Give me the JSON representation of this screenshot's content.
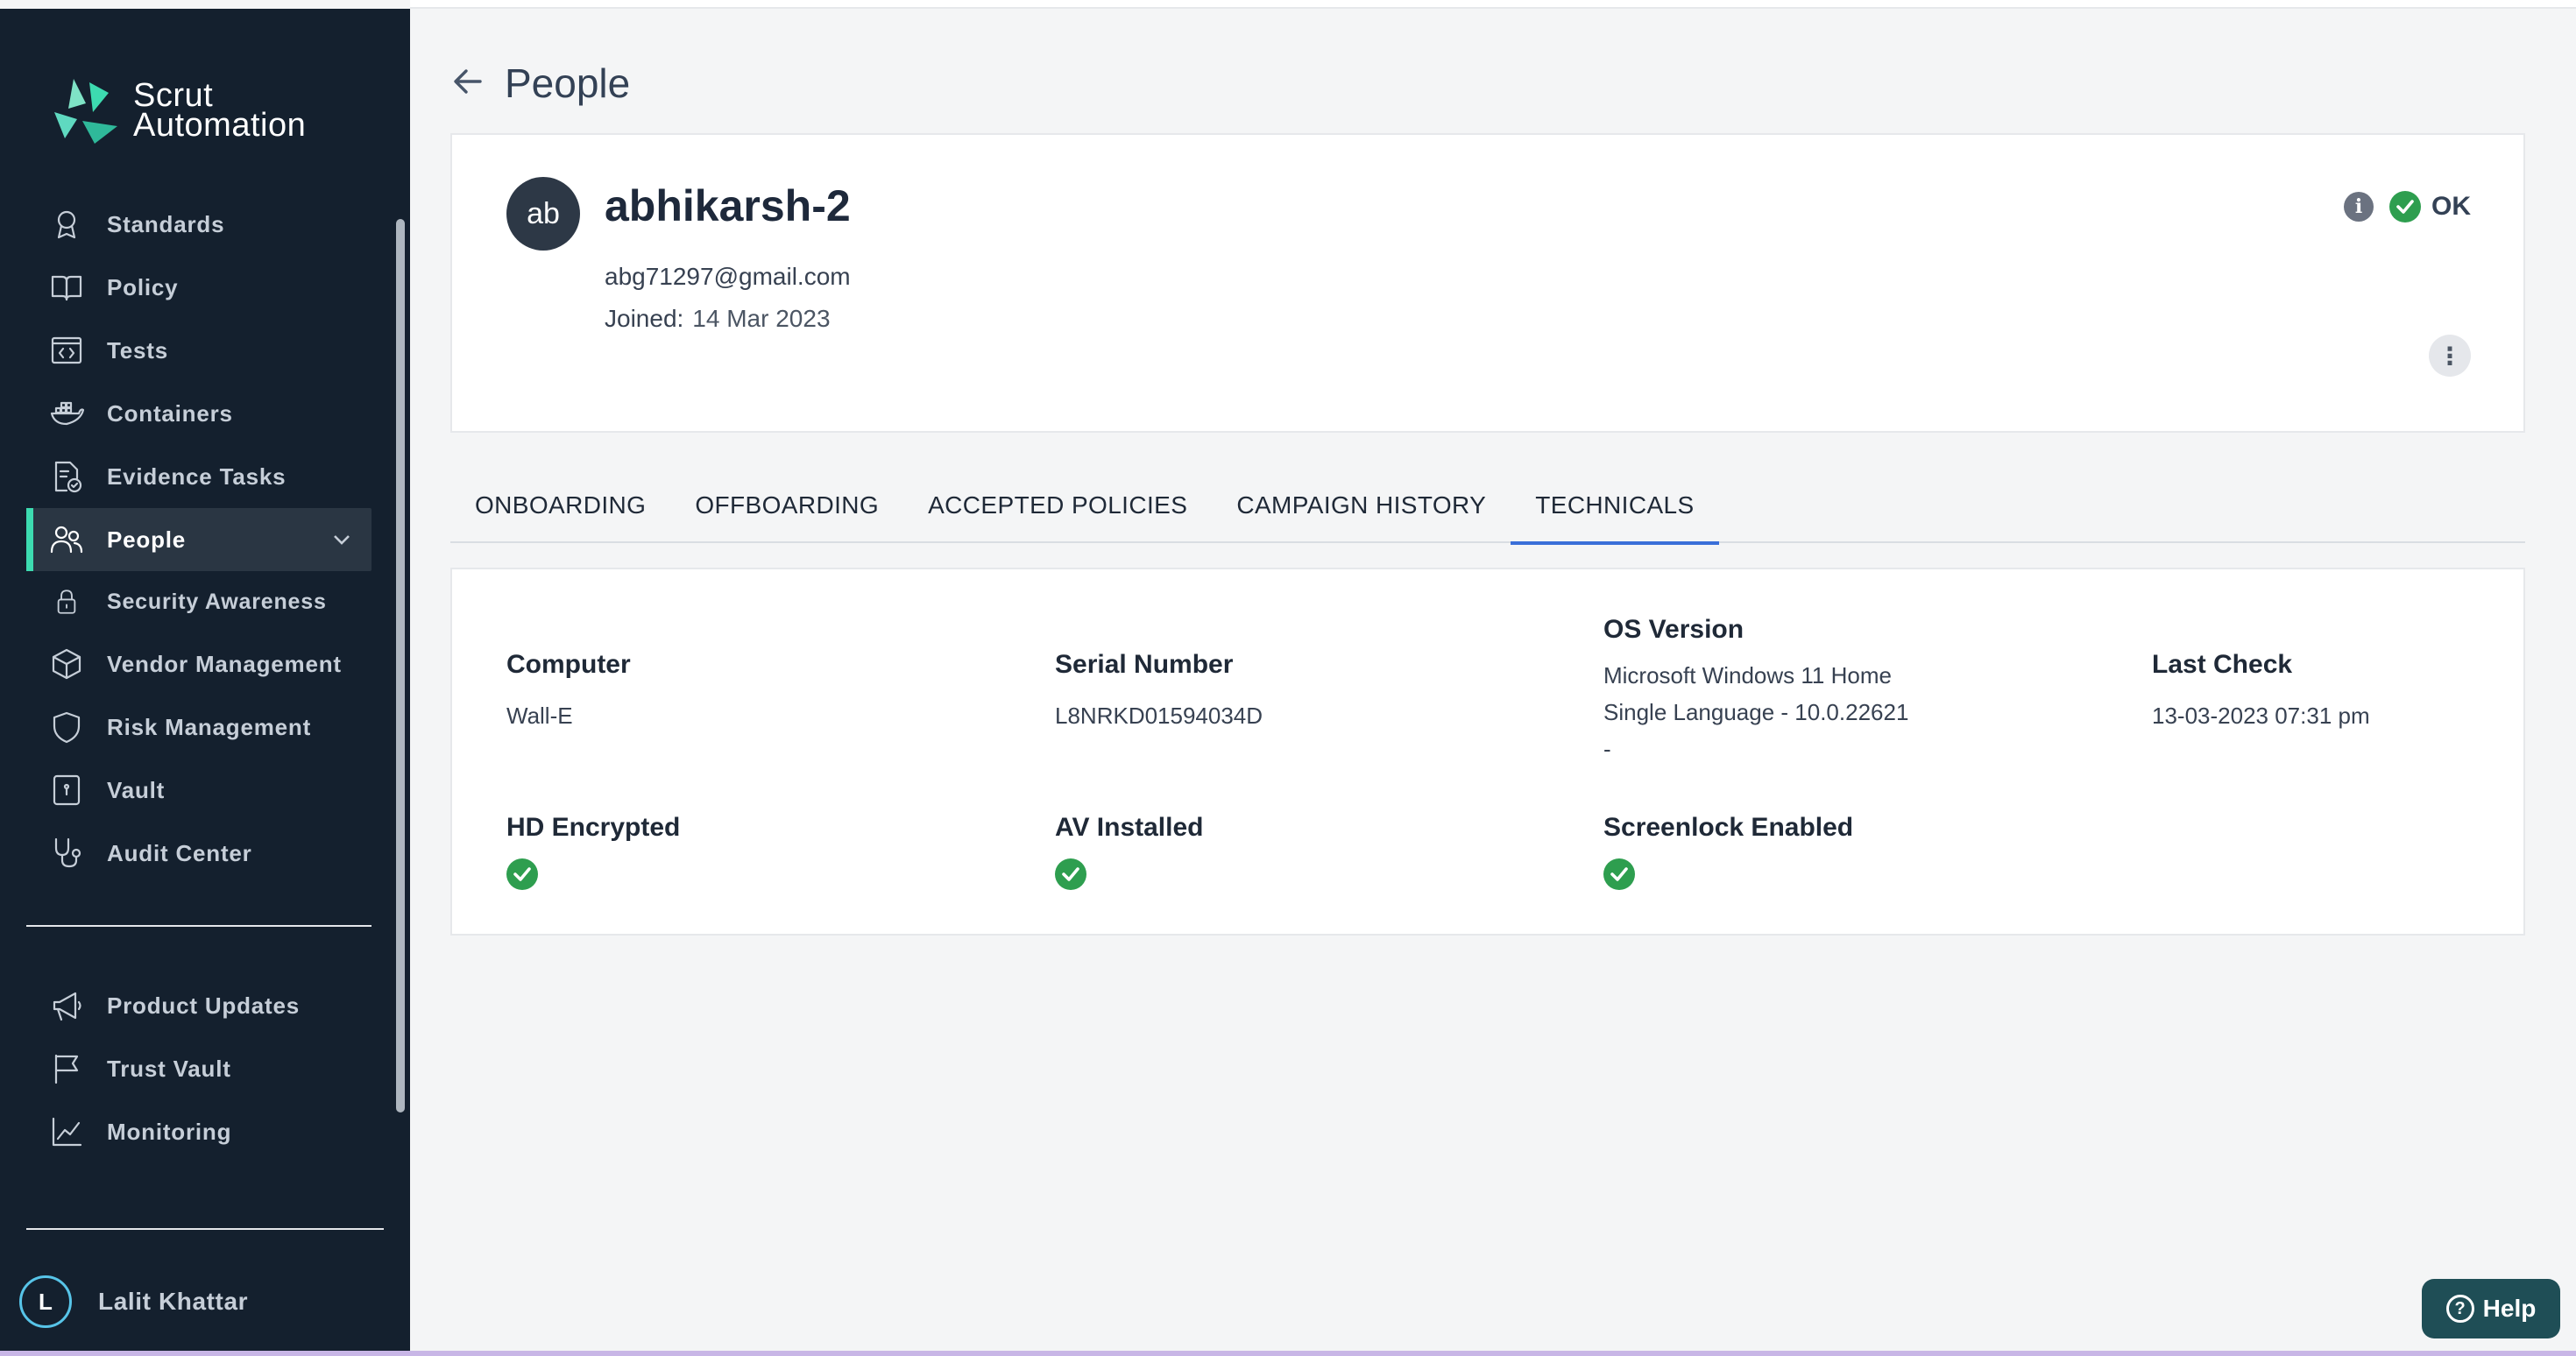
{
  "brand": {
    "line1": "Scrut",
    "line2": "Automation"
  },
  "sidebar": {
    "items": [
      {
        "label": "Standards",
        "icon": "award-icon"
      },
      {
        "label": "Policy",
        "icon": "book-icon"
      },
      {
        "label": "Tests",
        "icon": "code-window-icon"
      },
      {
        "label": "Containers",
        "icon": "docker-icon"
      },
      {
        "label": "Evidence Tasks",
        "icon": "task-document-icon"
      },
      {
        "label": "People",
        "icon": "users-icon",
        "active": true
      },
      {
        "label": "Security Awareness",
        "icon": "lock-icon"
      },
      {
        "label": "Vendor Management",
        "icon": "box-icon"
      },
      {
        "label": "Risk Management",
        "icon": "shield-icon"
      },
      {
        "label": "Vault",
        "icon": "vault-icon"
      },
      {
        "label": "Audit Center",
        "icon": "stethoscope-icon"
      }
    ],
    "secondary": [
      {
        "label": "Product Updates",
        "icon": "megaphone-icon"
      },
      {
        "label": "Trust Vault",
        "icon": "flag-icon"
      },
      {
        "label": "Monitoring",
        "icon": "chart-line-icon"
      }
    ],
    "user": {
      "initial": "L",
      "name": "Lalit Khattar"
    }
  },
  "page": {
    "title": "People"
  },
  "profile": {
    "initials": "ab",
    "name": "abhikarsh-2",
    "email": "abg71297@gmail.com",
    "joined_label": "Joined:",
    "joined_value": "14 Mar 2023",
    "status": "OK"
  },
  "tabs": [
    "ONBOARDING",
    "OFFBOARDING",
    "ACCEPTED POLICIES",
    "CAMPAIGN HISTORY",
    "TECHNICALS"
  ],
  "active_tab": "TECHNICALS",
  "technicals": {
    "computer": {
      "label": "Computer",
      "value": "Wall-E"
    },
    "serial": {
      "label": "Serial Number",
      "value": "L8NRKD01594034D"
    },
    "os": {
      "label": "OS Version",
      "line1": "Microsoft Windows 11 Home",
      "line2": "Single Language - 10.0.22621",
      "line3": "-"
    },
    "last_check": {
      "label": "Last Check",
      "value": "13-03-2023 07:31 pm"
    },
    "hd": {
      "label": "HD Encrypted",
      "checked": true
    },
    "av": {
      "label": "AV Installed",
      "checked": true
    },
    "screenlock": {
      "label": "Screenlock Enabled",
      "checked": true
    }
  },
  "help": {
    "label": "Help"
  },
  "colors": {
    "sidebar_bg": "#14202e",
    "accent": "#3ddbb0",
    "ok_green": "#2e9e4f",
    "tab_active": "#3a6fd8"
  }
}
